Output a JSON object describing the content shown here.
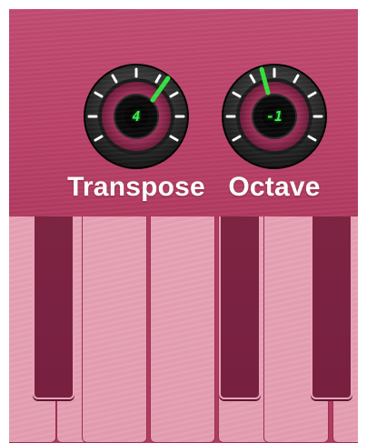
{
  "colors": {
    "panel": "#bb4269",
    "white_key": "#e59eb2",
    "black_key": "#7a2242",
    "display_text": "#3cf04a",
    "indicator": "#35e03e"
  },
  "knobs": [
    {
      "label": "Transpose",
      "value": "4",
      "icon": "rotary-knob-icon"
    },
    {
      "label": "Octave",
      "value": "-1",
      "icon": "rotary-knob-icon"
    }
  ],
  "keyboard": {
    "white_keys": 6,
    "black_keys": 3
  }
}
